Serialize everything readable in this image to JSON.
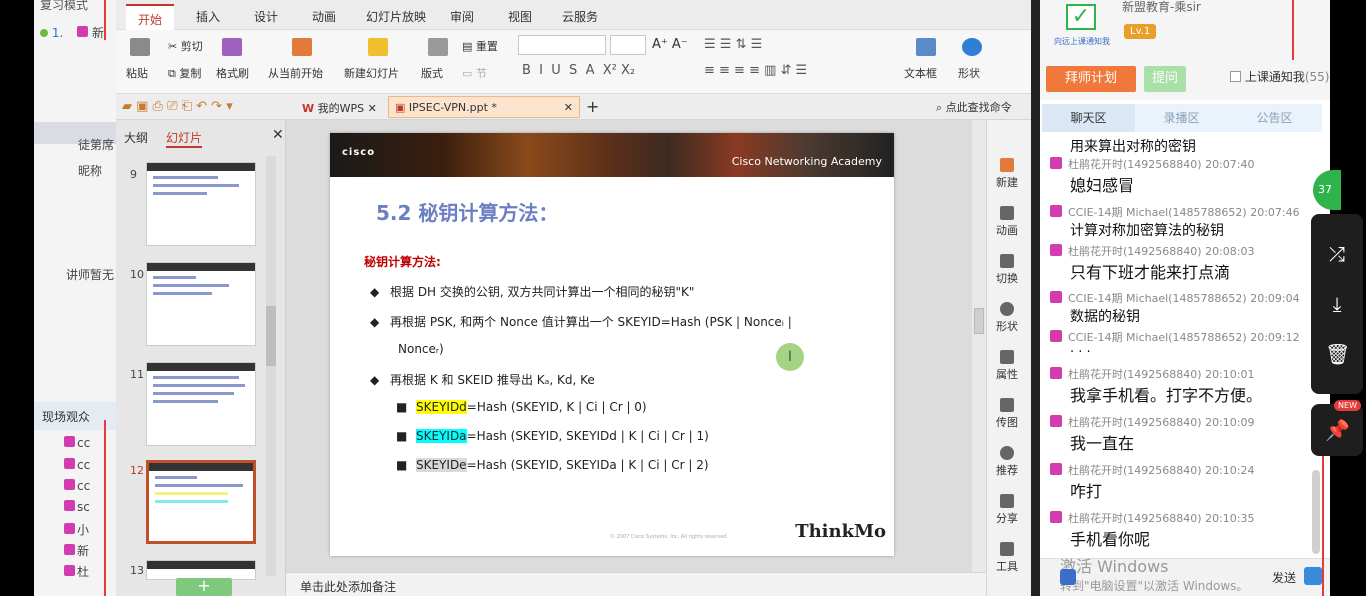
{
  "left_strip": {
    "top_text": "复习模式",
    "item1": "1.",
    "item1_label": "新",
    "label_host": "徒第席",
    "label_nick": "昵称",
    "label_teacher": "讲师暂无",
    "section_audience": "现场观众",
    "audience_rows": [
      "cc",
      "cc",
      "cc",
      "sc",
      "小",
      "新",
      "杜"
    ]
  },
  "wps": {
    "menu_tabs": [
      "开始",
      "插入",
      "设计",
      "动画",
      "幻灯片放映",
      "审阅",
      "视图",
      "云服务"
    ],
    "ribbon": {
      "paste": "粘贴",
      "cut": "剪切",
      "copy": "复制",
      "format_painter": "格式刷",
      "from_current": "从当前开始",
      "new_slide": "新建幻灯片",
      "layout": "版式",
      "reset": "重置",
      "section": "节",
      "textbox": "文本框",
      "shape": "形状"
    },
    "doc_tabs": [
      "我的WPS",
      "IPSEC-VPN.ppt *"
    ],
    "search_cmd": "点此查找命令",
    "pane_tabs": [
      "大纲",
      "幻灯片"
    ],
    "thumbnails": [
      9,
      10,
      11,
      12,
      13
    ],
    "selected_thumb": 12,
    "right_tools": [
      "新建",
      "动画",
      "切换",
      "形状",
      "属性",
      "传图",
      "推荐",
      "分享",
      "工具"
    ],
    "notes_placeholder": "单击此处添加备注",
    "add_slide": "+"
  },
  "slide": {
    "logo": "cisco",
    "academy": "Cisco Networking Academy",
    "title": "5.2 秘钥计算方法：",
    "subhead": "秘钥计算方法:",
    "bullet1": "根据  DH  交换的公钥, 双方共同计算出一个相同的秘钥\"K\"",
    "bullet2a": "再根据  PSK,  和两个  Nonce  值计算出一个  SKEYID=Hash  (PSK  |  Nonceᵢ  |",
    "bullet2b": "Nonceᵣ)",
    "bullet3": "再根据  K  和  SKEID  推导出  Kₐ, Kd, Ke",
    "sub1_key": "SKEYIDd",
    "sub1_rest": "=Hash (SKEYID, K | Ci | Cr | 0)",
    "sub2_key": "SKEYIDa",
    "sub2_rest": "=Hash (SKEYID, SKEYIDd | K | Ci | Cr | 1)",
    "sub3_key": "SKEYIDe",
    "sub3_rest": "=Hash (SKEYID, SKEYIDa | K | Ci | Cr | 2)",
    "brand": "ThinkMo",
    "footer": "© 2007 Cisco Systems, Inc. All rights reserved."
  },
  "chat": {
    "org": "新盟教育-乘sir",
    "level": "Lv.1",
    "slogan": "向远上课通知我",
    "btn_plan": "拜师计划",
    "btn_ask": "提问",
    "notify_label": "上课通知我",
    "notify_count": "(55)",
    "tabs": [
      "聊天区",
      "录播区",
      "公告区"
    ],
    "messages": [
      {
        "meta": "",
        "text": "用来算出对称的密钥"
      },
      {
        "meta": "杜鹃花开时(1492568840) 20:07:40",
        "text": "媳妇感冒"
      },
      {
        "meta": "CCIE-14期 Michael(1485788652) 20:07:46",
        "text": "计算对称加密算法的秘钥"
      },
      {
        "meta": "杜鹃花开时(1492568840) 20:08:03",
        "text": "只有下班才能来打点滴"
      },
      {
        "meta": "CCIE-14期 Michael(1485788652) 20:09:04",
        "text": "数据的秘钥"
      },
      {
        "meta": "CCIE-14期 Michael(1485788652) 20:09:12",
        "text": "· · ·"
      },
      {
        "meta": "杜鹃花开时(1492568840) 20:10:01",
        "text": "我拿手机看。打字不方便。"
      },
      {
        "meta": "杜鹃花开时(1492568840) 20:10:09",
        "text": "我一直在"
      },
      {
        "meta": "杜鹃花开时(1492568840) 20:10:24",
        "text": "咋打"
      },
      {
        "meta": "杜鹃花开时(1492568840) 20:10:35",
        "text": "手机看你呢"
      }
    ],
    "watermark_1": "激活 Windows",
    "watermark_2": "转到\"电脑设置\"以激活 Windows。",
    "send": "发送",
    "green_badge": "37"
  },
  "share": {
    "new_badge": "NEW"
  }
}
